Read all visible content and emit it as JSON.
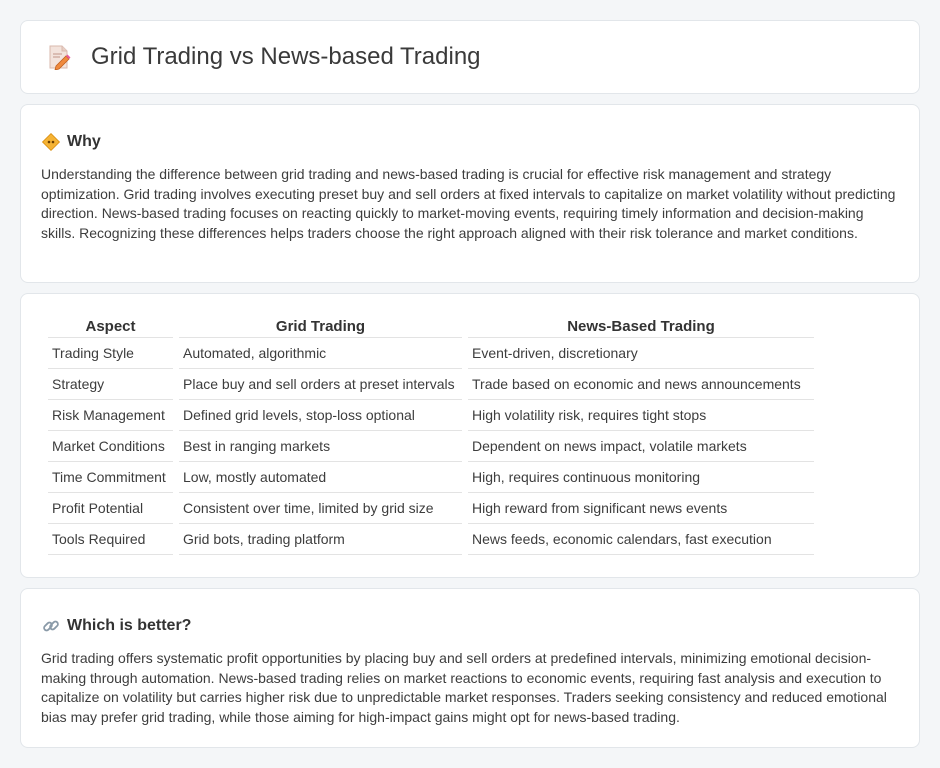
{
  "header": {
    "title": "Grid Trading vs News-based Trading",
    "icon": "document-pencil-icon"
  },
  "why": {
    "heading": "Why",
    "icon": "diamond-sign-icon",
    "text": "Understanding the difference between grid trading and news-based trading is crucial for effective risk management and strategy optimization. Grid trading involves executing preset buy and sell orders at fixed intervals to capitalize on market volatility without predicting direction. News-based trading focuses on reacting quickly to market-moving events, requiring timely information and decision-making skills. Recognizing these differences helps traders choose the right approach aligned with their risk tolerance and market conditions."
  },
  "table": {
    "headers": [
      "Aspect",
      "Grid Trading",
      "News-Based Trading"
    ],
    "rows": [
      [
        "Trading Style",
        "Automated, algorithmic",
        "Event-driven, discretionary"
      ],
      [
        "Strategy",
        "Place buy and sell orders at preset intervals",
        "Trade based on economic and news announcements"
      ],
      [
        "Risk Management",
        "Defined grid levels, stop-loss optional",
        "High volatility risk, requires tight stops"
      ],
      [
        "Market Conditions",
        "Best in ranging markets",
        "Dependent on news impact, volatile markets"
      ],
      [
        "Time Commitment",
        "Low, mostly automated",
        "High, requires continuous monitoring"
      ],
      [
        "Profit Potential",
        "Consistent over time, limited by grid size",
        "High reward from significant news events"
      ],
      [
        "Tools Required",
        "Grid bots, trading platform",
        "News feeds, economic calendars, fast execution"
      ]
    ]
  },
  "better": {
    "heading": "Which is better?",
    "icon": "link-icon",
    "text": "Grid trading offers systematic profit opportunities by placing buy and sell orders at predefined intervals, minimizing emotional decision-making through automation. News-based trading relies on market reactions to economic events, requiring fast analysis and execution to capitalize on volatility but carries higher risk due to unpredictable market responses. Traders seeking consistency and reduced emotional bias may prefer grid trading, while those aiming for high-impact gains might opt for news-based trading."
  }
}
